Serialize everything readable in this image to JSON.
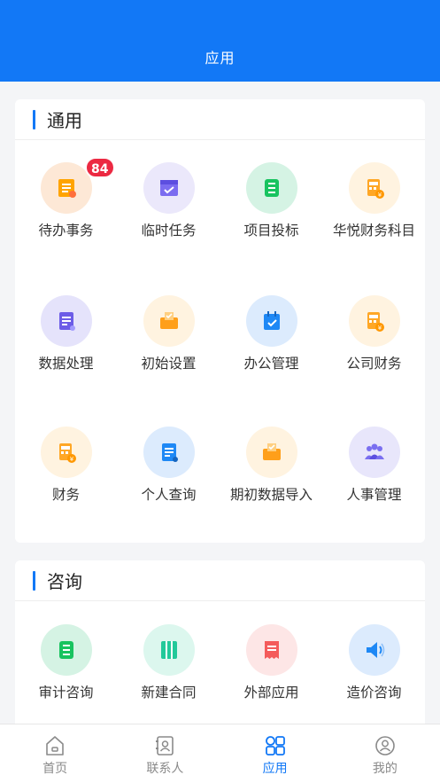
{
  "header": {
    "title": "应用"
  },
  "sections": [
    {
      "title": "通用",
      "items": [
        {
          "label": "待办事务",
          "badge": "84",
          "icon": "todo-icon"
        },
        {
          "label": "临时任务",
          "icon": "temp-task-icon"
        },
        {
          "label": "项目投标",
          "icon": "bidding-icon"
        },
        {
          "label": "华悦财务科目",
          "icon": "calculator-icon"
        },
        {
          "label": "数据处理",
          "icon": "data-doc-icon"
        },
        {
          "label": "初始设置",
          "icon": "box-icon"
        },
        {
          "label": "办公管理",
          "icon": "calendar-icon"
        },
        {
          "label": "公司财务",
          "icon": "calculator-icon"
        },
        {
          "label": "财务",
          "icon": "calculator-icon"
        },
        {
          "label": "个人查询",
          "icon": "doc-search-icon"
        },
        {
          "label": "期初数据导入",
          "icon": "box-icon"
        },
        {
          "label": "人事管理",
          "icon": "people-icon"
        }
      ]
    },
    {
      "title": "咨询",
      "items": [
        {
          "label": "审计咨询",
          "icon": "list-icon"
        },
        {
          "label": "新建合同",
          "icon": "contract-icon"
        },
        {
          "label": "外部应用",
          "icon": "receipt-icon"
        },
        {
          "label": "造价咨询",
          "icon": "speaker-icon"
        }
      ]
    }
  ],
  "tabbar": [
    {
      "label": "首页",
      "icon": "home-icon",
      "active": false
    },
    {
      "label": "联系人",
      "icon": "contacts-icon",
      "active": false
    },
    {
      "label": "应用",
      "icon": "apps-grid-icon",
      "active": true
    },
    {
      "label": "我的",
      "icon": "user-icon",
      "active": false
    }
  ],
  "colors": {
    "primary": "#1278f6",
    "badge": "#ec2942"
  }
}
